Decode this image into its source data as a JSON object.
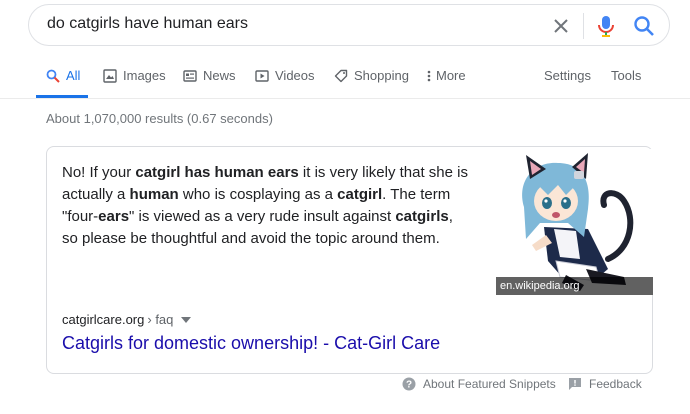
{
  "search": {
    "query": "do catgirls have human ears"
  },
  "tabs": [
    {
      "label": "All",
      "icon": "search-icon",
      "active": true
    },
    {
      "label": "Images",
      "icon": "image-icon"
    },
    {
      "label": "News",
      "icon": "news-icon"
    },
    {
      "label": "Videos",
      "icon": "play-icon"
    },
    {
      "label": "Shopping",
      "icon": "tag-icon"
    },
    {
      "label": "More",
      "icon": "more-vert-icon"
    }
  ],
  "tools": {
    "settings_label": "Settings",
    "tools_label": "Tools"
  },
  "results": {
    "stats": "About 1,070,000 results (0.67 seconds)"
  },
  "snippet": {
    "text_runs": [
      {
        "t": "No! If your ",
        "b": false
      },
      {
        "t": "catgirl has human ears",
        "b": true
      },
      {
        "t": " it is very likely that she is actually a ",
        "b": false
      },
      {
        "t": "human",
        "b": true
      },
      {
        "t": " who is cosplaying as a ",
        "b": false
      },
      {
        "t": "catgirl",
        "b": true
      },
      {
        "t": ". The term \"four-",
        "b": false
      },
      {
        "t": "ears",
        "b": true
      },
      {
        "t": "\" is viewed as a very rude insult against ",
        "b": false
      },
      {
        "t": "catgirls",
        "b": true
      },
      {
        "t": ", so please be thoughtful and avoid the topic around them.",
        "b": false
      }
    ],
    "image_credit": "en.wikipedia.org",
    "source_domain": "catgirlcare.org",
    "source_path": "› faq",
    "title": "Catgirls for domestic ownership! - Cat-Girl Care"
  },
  "footer": {
    "about_label": "About Featured Snippets",
    "feedback_label": "Feedback"
  },
  "colors": {
    "link": "#1a0dab",
    "accent": "#1a73e8",
    "muted": "#70757a"
  }
}
